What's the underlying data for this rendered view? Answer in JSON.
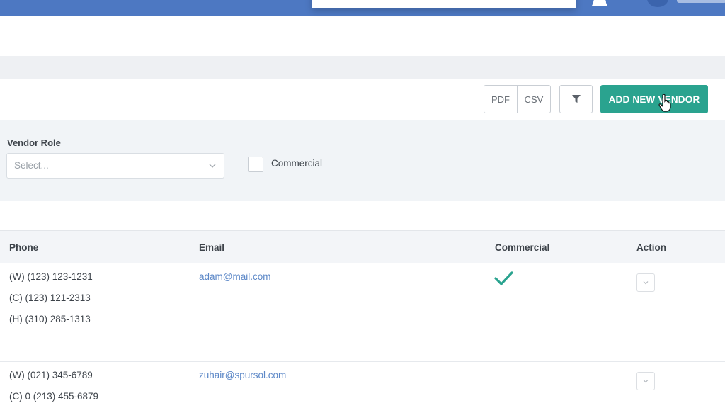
{
  "toolbar": {
    "pdf_label": "PDF",
    "csv_label": "CSV",
    "add_vendor_label": "ADD NEW VENDOR"
  },
  "filters": {
    "vendor_role_label": "Vendor Role",
    "vendor_role_placeholder": "Select...",
    "commercial_label": "Commercial",
    "commercial_checked": false
  },
  "table": {
    "columns": [
      "Phone",
      "Email",
      "Commercial",
      "Action"
    ],
    "rows": [
      {
        "phones": [
          "(W) (123) 123-1231",
          "(C) (123) 121-2313",
          "(H) (310) 285-1313"
        ],
        "email": "adam@mail.com",
        "commercial": true
      },
      {
        "phones": [
          "(W) (021) 345-6789",
          "(C) 0 (213) 455-6879"
        ],
        "email": "zuhair@spursol.com",
        "commercial": false
      }
    ]
  },
  "colors": {
    "header_blue": "#4d78c2",
    "accent_green": "#2aa38f",
    "link_blue": "#5b87c7"
  }
}
